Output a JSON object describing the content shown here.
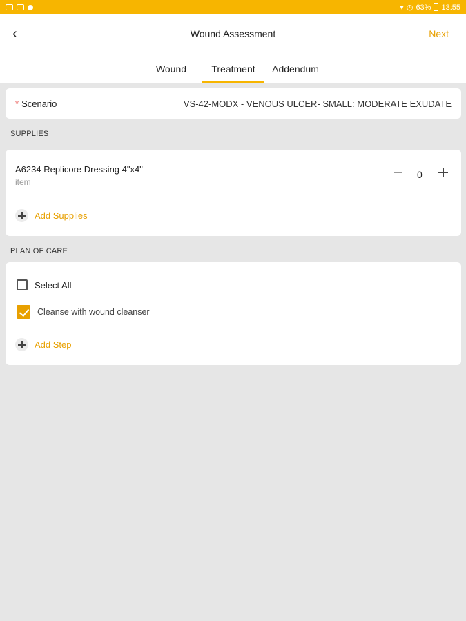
{
  "status_bar": {
    "battery": "63%",
    "time": "13:55"
  },
  "header": {
    "title": "Wound Assessment",
    "next_label": "Next",
    "back_icon": "arrow-left-icon"
  },
  "tabs": [
    {
      "label": "Wound",
      "active": false
    },
    {
      "label": "Treatment",
      "active": true
    },
    {
      "label": "Addendum",
      "active": false
    }
  ],
  "scenario": {
    "required_marker": "*",
    "label": "Scenario",
    "value": "VS-42-MODX - VENOUS ULCER- SMALL: MODERATE EXUDATE"
  },
  "supplies": {
    "section_title": "SUPPLIES",
    "items": [
      {
        "name": "A6234 Replicore Dressing 4\"x4\"",
        "unit": "item",
        "quantity": "0"
      }
    ],
    "add_label": "Add Supplies"
  },
  "plan_of_care": {
    "section_title": "PLAN OF CARE",
    "select_all_label": "Select All",
    "select_all_checked": false,
    "steps": [
      {
        "label": "Cleanse with wound cleanser",
        "checked": true
      }
    ],
    "add_label": "Add Step"
  },
  "colors": {
    "accent": "#f7b500",
    "link": "#e8a000",
    "background": "#e6e6e6"
  }
}
